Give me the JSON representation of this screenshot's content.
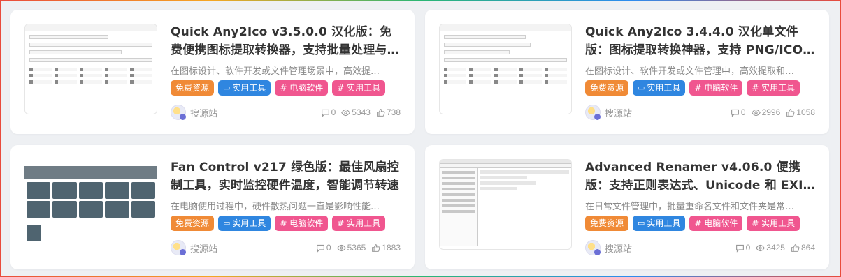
{
  "cards": [
    {
      "title": "Quick Any2Ico v3.5.0.0 汉化版：免费便携图标提取转换器，支持批量处理与 PNG…",
      "desc": "在图标设计、软件开发或文件管理场景中，高效提…",
      "tags": [
        "免费资源",
        "实用工具",
        "# 电脑软件",
        "# 实用工具"
      ],
      "author": "搜源站",
      "comments": "0",
      "views": "5343",
      "likes": "738"
    },
    {
      "title": "Quick Any2Ico 3.4.4.0 汉化单文件版：图标提取转换神器，支持 PNG/ICO 格式批…",
      "desc": "在图标设计、软件开发或文件管理中，高效提取和…",
      "tags": [
        "免费资源",
        "实用工具",
        "# 电脑软件",
        "# 实用工具"
      ],
      "author": "搜源站",
      "comments": "0",
      "views": "2996",
      "likes": "1058"
    },
    {
      "title": "Fan Control v217 绿色版：最佳风扇控制工具，实时监控硬件温度，智能调节转速",
      "desc": "在电脑使用过程中，硬件散热问题一直是影响性能…",
      "tags": [
        "免费资源",
        "实用工具",
        "# 电脑软件",
        "# 实用工具"
      ],
      "author": "搜源站",
      "comments": "0",
      "views": "5365",
      "likes": "1883"
    },
    {
      "title": "Advanced Renamer v4.06.0 便携版：支持正则表达式、Unicode 和 EXIF 的高级批…",
      "desc": "在日常文件管理中，批量重命名文件和文件夹是常…",
      "tags": [
        "免费资源",
        "实用工具",
        "# 电脑软件",
        "# 实用工具"
      ],
      "author": "搜源站",
      "comments": "0",
      "views": "3425",
      "likes": "864"
    }
  ],
  "colors": {
    "tag_orange": "#f08a36",
    "tag_blue": "#2f86e0",
    "tag_pink": "#f0568f"
  },
  "icons": [
    "folder-icon",
    "comment-icon",
    "eye-icon",
    "thumbs-up-icon"
  ]
}
